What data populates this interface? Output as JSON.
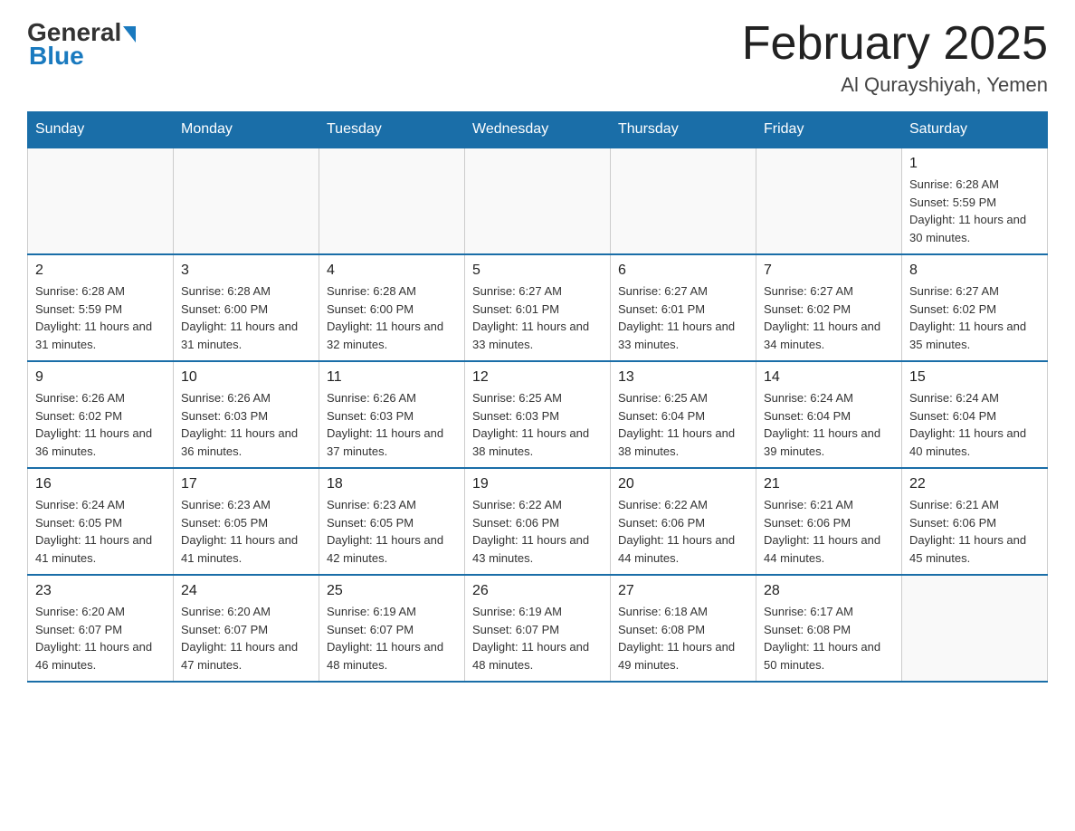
{
  "header": {
    "logo_general": "General",
    "logo_blue": "Blue",
    "month_title": "February 2025",
    "location": "Al Qurayshiyah, Yemen"
  },
  "days_of_week": [
    "Sunday",
    "Monday",
    "Tuesday",
    "Wednesday",
    "Thursday",
    "Friday",
    "Saturday"
  ],
  "weeks": [
    [
      {
        "day": "",
        "info": ""
      },
      {
        "day": "",
        "info": ""
      },
      {
        "day": "",
        "info": ""
      },
      {
        "day": "",
        "info": ""
      },
      {
        "day": "",
        "info": ""
      },
      {
        "day": "",
        "info": ""
      },
      {
        "day": "1",
        "info": "Sunrise: 6:28 AM\nSunset: 5:59 PM\nDaylight: 11 hours and 30 minutes."
      }
    ],
    [
      {
        "day": "2",
        "info": "Sunrise: 6:28 AM\nSunset: 5:59 PM\nDaylight: 11 hours and 31 minutes."
      },
      {
        "day": "3",
        "info": "Sunrise: 6:28 AM\nSunset: 6:00 PM\nDaylight: 11 hours and 31 minutes."
      },
      {
        "day": "4",
        "info": "Sunrise: 6:28 AM\nSunset: 6:00 PM\nDaylight: 11 hours and 32 minutes."
      },
      {
        "day": "5",
        "info": "Sunrise: 6:27 AM\nSunset: 6:01 PM\nDaylight: 11 hours and 33 minutes."
      },
      {
        "day": "6",
        "info": "Sunrise: 6:27 AM\nSunset: 6:01 PM\nDaylight: 11 hours and 33 minutes."
      },
      {
        "day": "7",
        "info": "Sunrise: 6:27 AM\nSunset: 6:02 PM\nDaylight: 11 hours and 34 minutes."
      },
      {
        "day": "8",
        "info": "Sunrise: 6:27 AM\nSunset: 6:02 PM\nDaylight: 11 hours and 35 minutes."
      }
    ],
    [
      {
        "day": "9",
        "info": "Sunrise: 6:26 AM\nSunset: 6:02 PM\nDaylight: 11 hours and 36 minutes."
      },
      {
        "day": "10",
        "info": "Sunrise: 6:26 AM\nSunset: 6:03 PM\nDaylight: 11 hours and 36 minutes."
      },
      {
        "day": "11",
        "info": "Sunrise: 6:26 AM\nSunset: 6:03 PM\nDaylight: 11 hours and 37 minutes."
      },
      {
        "day": "12",
        "info": "Sunrise: 6:25 AM\nSunset: 6:03 PM\nDaylight: 11 hours and 38 minutes."
      },
      {
        "day": "13",
        "info": "Sunrise: 6:25 AM\nSunset: 6:04 PM\nDaylight: 11 hours and 38 minutes."
      },
      {
        "day": "14",
        "info": "Sunrise: 6:24 AM\nSunset: 6:04 PM\nDaylight: 11 hours and 39 minutes."
      },
      {
        "day": "15",
        "info": "Sunrise: 6:24 AM\nSunset: 6:04 PM\nDaylight: 11 hours and 40 minutes."
      }
    ],
    [
      {
        "day": "16",
        "info": "Sunrise: 6:24 AM\nSunset: 6:05 PM\nDaylight: 11 hours and 41 minutes."
      },
      {
        "day": "17",
        "info": "Sunrise: 6:23 AM\nSunset: 6:05 PM\nDaylight: 11 hours and 41 minutes."
      },
      {
        "day": "18",
        "info": "Sunrise: 6:23 AM\nSunset: 6:05 PM\nDaylight: 11 hours and 42 minutes."
      },
      {
        "day": "19",
        "info": "Sunrise: 6:22 AM\nSunset: 6:06 PM\nDaylight: 11 hours and 43 minutes."
      },
      {
        "day": "20",
        "info": "Sunrise: 6:22 AM\nSunset: 6:06 PM\nDaylight: 11 hours and 44 minutes."
      },
      {
        "day": "21",
        "info": "Sunrise: 6:21 AM\nSunset: 6:06 PM\nDaylight: 11 hours and 44 minutes."
      },
      {
        "day": "22",
        "info": "Sunrise: 6:21 AM\nSunset: 6:06 PM\nDaylight: 11 hours and 45 minutes."
      }
    ],
    [
      {
        "day": "23",
        "info": "Sunrise: 6:20 AM\nSunset: 6:07 PM\nDaylight: 11 hours and 46 minutes."
      },
      {
        "day": "24",
        "info": "Sunrise: 6:20 AM\nSunset: 6:07 PM\nDaylight: 11 hours and 47 minutes."
      },
      {
        "day": "25",
        "info": "Sunrise: 6:19 AM\nSunset: 6:07 PM\nDaylight: 11 hours and 48 minutes."
      },
      {
        "day": "26",
        "info": "Sunrise: 6:19 AM\nSunset: 6:07 PM\nDaylight: 11 hours and 48 minutes."
      },
      {
        "day": "27",
        "info": "Sunrise: 6:18 AM\nSunset: 6:08 PM\nDaylight: 11 hours and 49 minutes."
      },
      {
        "day": "28",
        "info": "Sunrise: 6:17 AM\nSunset: 6:08 PM\nDaylight: 11 hours and 50 minutes."
      },
      {
        "day": "",
        "info": ""
      }
    ]
  ]
}
